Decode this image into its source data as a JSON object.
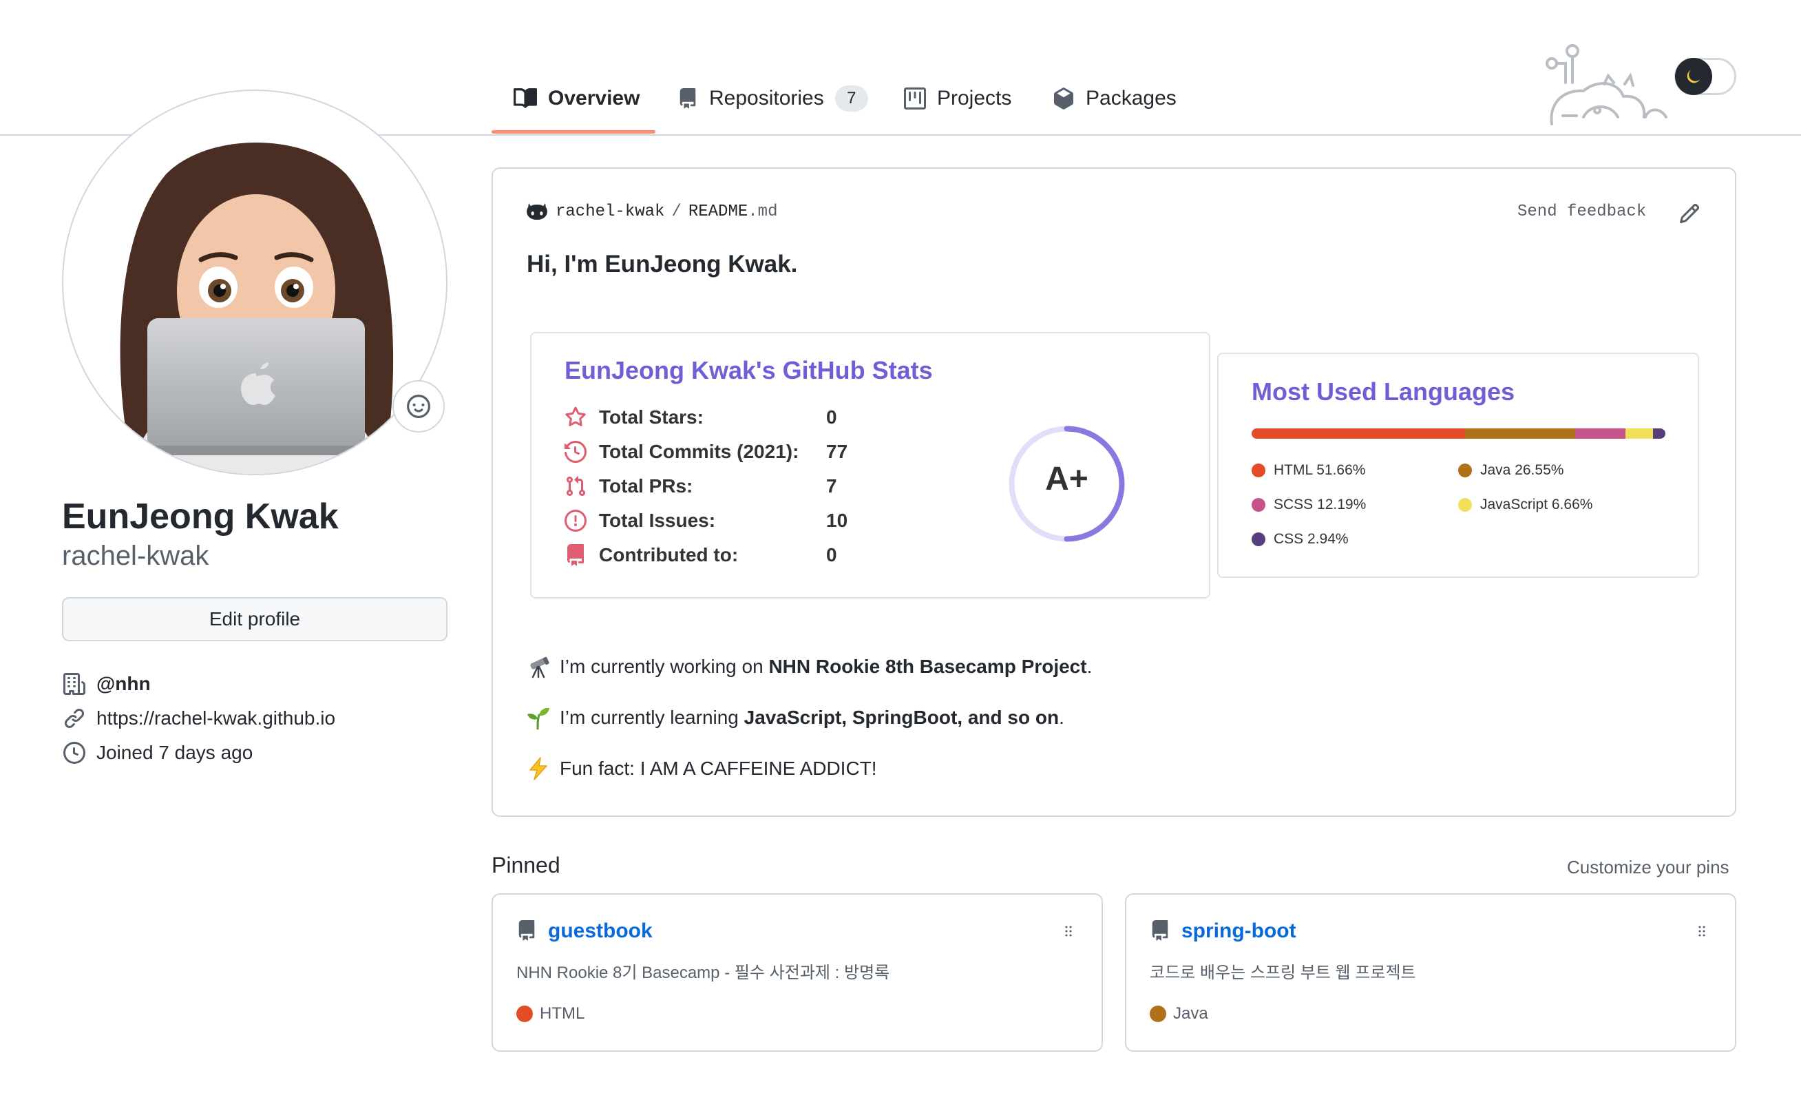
{
  "tabs": [
    {
      "label": "Overview",
      "icon": "book-icon",
      "active": true
    },
    {
      "label": "Repositories",
      "icon": "repo-icon",
      "count": "7"
    },
    {
      "label": "Projects",
      "icon": "project-icon"
    },
    {
      "label": "Packages",
      "icon": "package-icon"
    }
  ],
  "theme_toggle": {
    "icon": "moon-icon",
    "state": "dark"
  },
  "profile": {
    "full_name": "EunJeong Kwak",
    "username": "rachel-kwak",
    "edit_label": "Edit profile",
    "organization": "@nhn",
    "website": "https://rachel-kwak.github.io",
    "joined": "Joined 7 days ago"
  },
  "readme": {
    "owner": "rachel-kwak",
    "separator": "/",
    "file_base": "README",
    "file_ext": ".md",
    "send_feedback": "Send feedback",
    "heading": "Hi, I'm EunJeong Kwak.",
    "bullets": [
      {
        "emoji": "telescope-icon",
        "pre": "I’m currently working on ",
        "bold": "NHN Rookie 8th Basecamp Project",
        "post": "."
      },
      {
        "emoji": "seedling-icon",
        "pre": "I’m currently learning ",
        "bold": "JavaScript, SpringBoot, and so on",
        "post": "."
      },
      {
        "emoji": "lightning-icon",
        "pre": "Fun fact: I AM A CAFFEINE ADDICT!",
        "bold": "",
        "post": ""
      }
    ]
  },
  "stats_card": {
    "title": "EunJeong Kwak's GitHub Stats",
    "accent_color": "#6f5fd6",
    "icon_color": "#e05d6f",
    "rows": [
      {
        "label": "Total Stars:",
        "value": "0",
        "icon": "star-icon"
      },
      {
        "label": "Total Commits (2021):",
        "value": "77",
        "icon": "history-icon"
      },
      {
        "label": "Total PRs:",
        "value": "7",
        "icon": "pull-request-icon"
      },
      {
        "label": "Total Issues:",
        "value": "10",
        "icon": "issue-icon"
      },
      {
        "label": "Contributed to:",
        "value": "0",
        "icon": "repo-icon"
      }
    ],
    "grade": "A+",
    "grade_progress": 0.5
  },
  "languages_card": {
    "title": "Most Used Languages",
    "languages": [
      {
        "name": "HTML",
        "percent": 51.66,
        "label": "HTML 51.66%",
        "color": "#e34c26"
      },
      {
        "name": "Java",
        "percent": 26.55,
        "label": "Java 26.55%",
        "color": "#b07219"
      },
      {
        "name": "SCSS",
        "percent": 12.19,
        "label": "SCSS 12.19%",
        "color": "#c6538c"
      },
      {
        "name": "JavaScript",
        "percent": 6.66,
        "label": "JavaScript 6.66%",
        "color": "#f1e05a"
      },
      {
        "name": "CSS",
        "percent": 2.94,
        "label": "CSS 2.94%",
        "color": "#563d7c"
      }
    ]
  },
  "pinned": {
    "title": "Pinned",
    "customize": "Customize your pins",
    "repos": [
      {
        "name": "guestbook",
        "description": "NHN Rookie 8기 Basecamp - 필수 사전과제 : 방명록",
        "language": "HTML",
        "language_color": "#e34c26"
      },
      {
        "name": "spring-boot",
        "description": "코드로 배우는 스프링 부트 웹 프로젝트",
        "language": "Java",
        "language_color": "#b07219"
      }
    ]
  }
}
